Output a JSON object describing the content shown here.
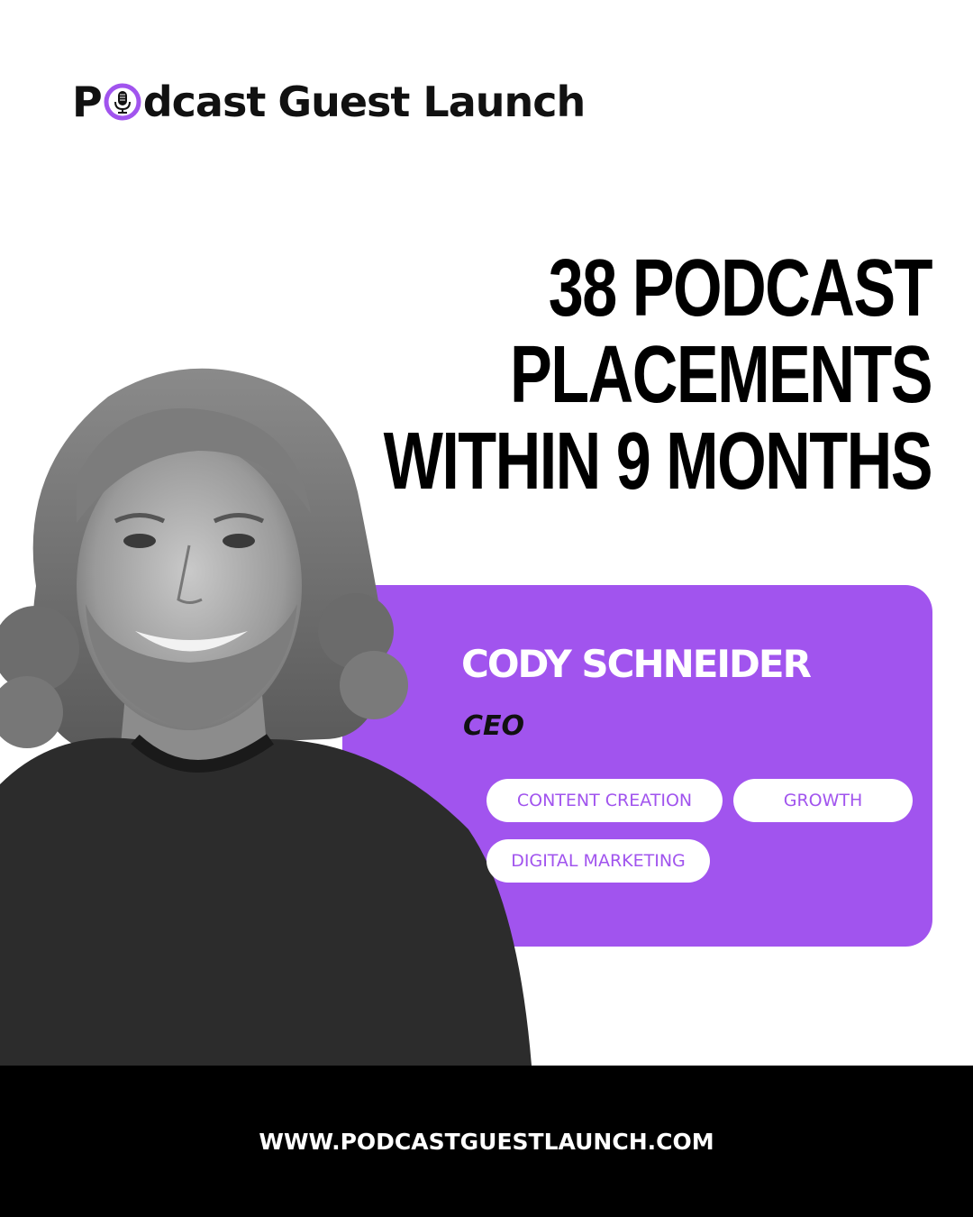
{
  "brand": {
    "logo_prefix": "P",
    "logo_suffix": "dcast",
    "logo_rest": "Guest Launch",
    "accent_color": "#a154ee",
    "logo_icon": "microphone-icon"
  },
  "headline": {
    "line1": "38 PODCAST",
    "line2": "PLACEMENTS",
    "line3": "WITHIN 9 MONTHS"
  },
  "guest": {
    "name": "CODY SCHNEIDER",
    "role": "CEO",
    "photo_icon": "guest-portrait"
  },
  "tags": [
    "CONTENT CREATION",
    "GROWTH",
    "DIGITAL MARKETING"
  ],
  "footer": {
    "url": "WWW.PODCASTGUESTLAUNCH.COM"
  }
}
